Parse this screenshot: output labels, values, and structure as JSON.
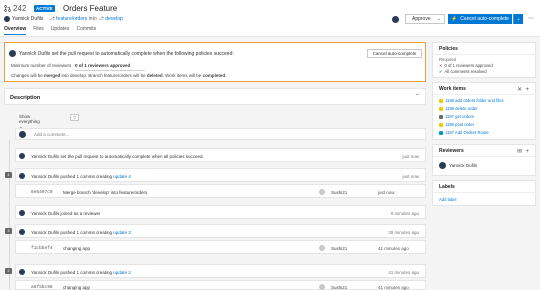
{
  "header": {
    "pr_number": "242",
    "status_badge": "ACTIVE",
    "title": "Orders Feature",
    "author": "Yannick Dufils",
    "branch_prefix": "",
    "source_branch": "feature/orders",
    "into_label": "into",
    "target_branch": "develop",
    "tabs": [
      {
        "label": "Overview"
      },
      {
        "label": "Files"
      },
      {
        "label": "Updates"
      },
      {
        "label": "Commits"
      }
    ],
    "approve_label": "Approve",
    "cancel_auto_label": "Cancel auto-complete",
    "more_glyph": "⋯"
  },
  "banner": {
    "title": "Yannick Dufils set the pull request to automatically complete when the following policies succeed:",
    "min_reviewers_label": "Minimum number of reviewers",
    "min_reviewers_value": "0 of 1 reviewers approved",
    "reviewers_approved_fraction": 0,
    "note_pre": "Changes will be ",
    "note_merged": "merged",
    "note_mid": " into develop. Branch feature/orders will be ",
    "note_deleted": "deleted",
    "note_mid2": ". Work items will be ",
    "note_completed": "completed",
    "note_end": ".",
    "cancel_button": "Cancel auto-complete"
  },
  "description": {
    "title": "Description"
  },
  "filter": {
    "show_everything": "Show everything ⌄"
  },
  "comment": {
    "placeholder": "Add a comment..."
  },
  "timeline": [
    {
      "kind": "event",
      "text": "Yannick Dufils set the pull request to automatically complete when all policies succeed.",
      "time": "just now"
    },
    {
      "kind": "update",
      "num": "4",
      "text": "Yannick Dufils pushed 1 commit creating ",
      "link": "update 4",
      "time": "just now"
    },
    {
      "kind": "commit",
      "hash": "8e6497c9",
      "message": "Merge branch 'develop' into feature/orders",
      "user": "Sushi21",
      "time": "just now"
    },
    {
      "kind": "event",
      "text": "Yannick Dufils joined as a reviewer",
      "time": "9 minutes ago"
    },
    {
      "kind": "update",
      "num": "3",
      "text": "Yannick Dufils pushed 1 commit creating ",
      "link": "update 3",
      "time": "39 minutes ago"
    },
    {
      "kind": "commit",
      "hash": "f1cbbef4",
      "message": "changing app",
      "user": "Sushi21",
      "time": "41 minutes ago"
    },
    {
      "kind": "update",
      "num": "2",
      "text": "Yannick Dufils pushed 1 commit creating ",
      "link": "update 2",
      "time": "41 minutes ago"
    },
    {
      "kind": "commit",
      "hash": "a8f5bc98",
      "message": "changing app",
      "user": "Sushi21",
      "time": "41 minutes ago"
    }
  ],
  "sidebar": {
    "policies": {
      "title": "Policies",
      "required_label": "Required",
      "items": [
        {
          "icon": "x-icon",
          "text": "0 of 1 reviewers approved"
        },
        {
          "icon": "check-icon",
          "text": "All comments resolved"
        }
      ]
    },
    "work_items": {
      "title": "Work items",
      "items": [
        {
          "text": "1196 add orders folder and files",
          "color": "#f2c811"
        },
        {
          "text": "1199 delete order",
          "color": "#f2c811"
        },
        {
          "text": "1197 get orders",
          "color": "#6b6b6b"
        },
        {
          "text": "1195 post order",
          "color": "#f2c811"
        },
        {
          "text": "1187 Add Orders Route",
          "color": "#009ccc"
        }
      ]
    },
    "reviewers": {
      "title": "Reviewers",
      "name": "Yannick Dufils"
    },
    "labels": {
      "title": "Labels",
      "add_label": "Add label"
    }
  },
  "colors": {
    "accent": "#0078d4",
    "banner_border": "#e8a03c",
    "fail": "#d13438",
    "ok": "#107c10"
  }
}
